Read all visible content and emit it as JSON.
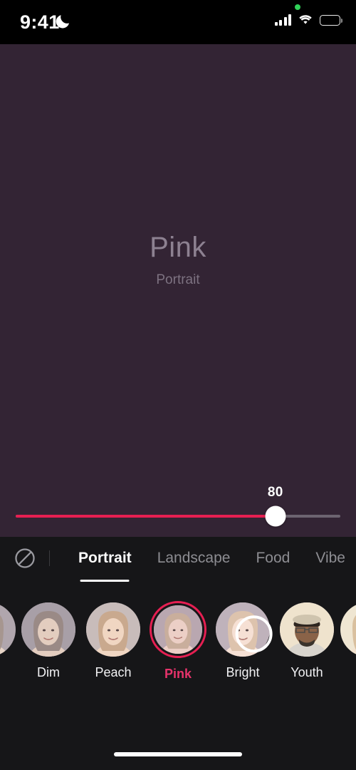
{
  "status_bar": {
    "time": "9:41",
    "dnd_icon": "moon-icon",
    "signal_icon": "cellular-signal-icon",
    "wifi_icon": "wifi-icon",
    "battery_icon": "battery-icon",
    "recording_dot_color": "#30d158"
  },
  "preview": {
    "filter_name": "Pink",
    "category": "Portrait",
    "background_color": "#332434"
  },
  "slider": {
    "value": "80",
    "value_number": 80,
    "min": 0,
    "max": 100,
    "fill_color": "#e61f52",
    "track_color": "#6c6470"
  },
  "tabbar": {
    "no_filter_icon": "no-filter-icon",
    "tabs": [
      {
        "label": "Portrait",
        "active": true
      },
      {
        "label": "Landscape",
        "active": false
      },
      {
        "label": "Food",
        "active": false
      },
      {
        "label": "Vibe",
        "active": false
      }
    ]
  },
  "filters": {
    "items": [
      {
        "label": "Dim",
        "selected": false,
        "downloading": false
      },
      {
        "label": "Peach",
        "selected": false,
        "downloading": false
      },
      {
        "label": "Pink",
        "selected": true,
        "downloading": false
      },
      {
        "label": "Bright",
        "selected": false,
        "downloading": true
      },
      {
        "label": "Youth",
        "selected": false,
        "downloading": false
      }
    ],
    "selected_color": "#e6336b"
  },
  "home_indicator": {
    "color": "#ffffff"
  }
}
